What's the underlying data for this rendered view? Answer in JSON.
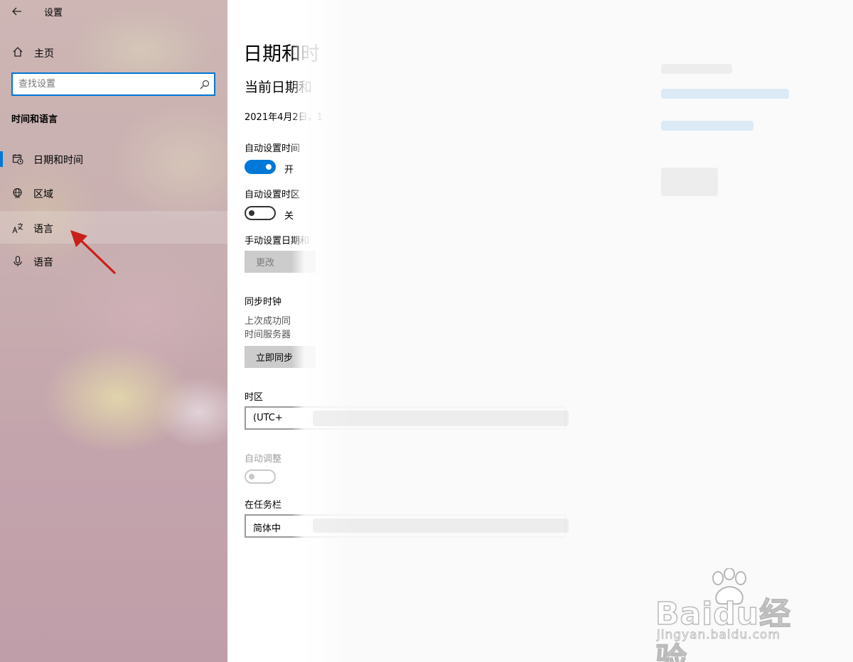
{
  "window": {
    "title": "设置"
  },
  "sidebar": {
    "home_label": "主页",
    "search_placeholder": "查找设置",
    "section_heading": "时间和语言",
    "items": [
      {
        "label": "日期和时间",
        "icon": "calendar-clock-icon",
        "selected": true
      },
      {
        "label": "区域",
        "icon": "globe-icon",
        "selected": false
      },
      {
        "label": "语言",
        "icon": "language-icon",
        "selected": false
      },
      {
        "label": "语音",
        "icon": "microphone-icon",
        "selected": false
      }
    ]
  },
  "main": {
    "page_title": "日期和时",
    "sub_title": "当前日期和",
    "current_datetime": "2021年4月2日，1",
    "auto_time": {
      "label": "自动设置时间",
      "state": "开"
    },
    "auto_timezone": {
      "label": "自动设置时区",
      "state": "关"
    },
    "manual": {
      "label": "手动设置日期和",
      "button": "更改"
    },
    "sync": {
      "label": "同步时钟",
      "line1": "上次成功同",
      "line2": "时间服务器",
      "button": "立即同步"
    },
    "timezone": {
      "label": "时区",
      "value": "(UTC+"
    },
    "dst": {
      "label": "自动调整"
    },
    "taskbar_calendar": {
      "label": "在任务栏",
      "value": "简体中"
    }
  },
  "watermark": {
    "brand": "Baidu经验",
    "url": "jingyan.baidu.com"
  },
  "colors": {
    "accent": "#0078d7",
    "annotation_arrow": "#c8201a"
  }
}
